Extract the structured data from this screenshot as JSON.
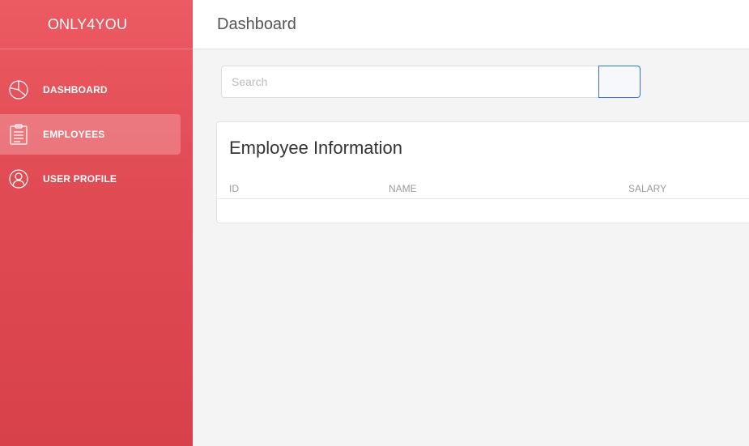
{
  "sidebar": {
    "brand": "ONLY4YOU",
    "items": [
      {
        "label": "DASHBOARD",
        "icon": "pie-chart-icon",
        "active": false
      },
      {
        "label": "EMPLOYEES",
        "icon": "clipboard-icon",
        "active": true
      },
      {
        "label": "USER PROFILE",
        "icon": "user-icon",
        "active": false
      }
    ]
  },
  "header": {
    "title": "Dashboard"
  },
  "search": {
    "placeholder": "Search",
    "value": "",
    "button_label": ""
  },
  "card": {
    "title": "Employee Information",
    "columns": [
      "ID",
      "NAME",
      "SALARY"
    ],
    "rows": []
  },
  "colors": {
    "sidebar_top": "#ec5a62",
    "sidebar_bottom": "#d8414a",
    "search_button_border": "#3a6fd8"
  }
}
